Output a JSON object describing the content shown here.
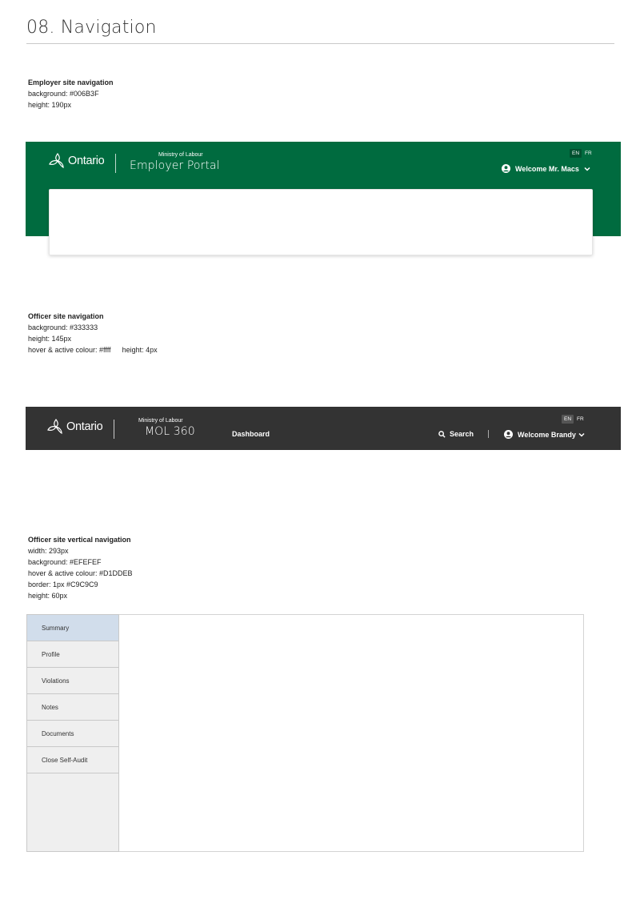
{
  "page": {
    "title": "08. Navigation"
  },
  "employer_spec": {
    "heading": "Employer site navigation",
    "lines": [
      "background: #006B3F",
      "height: 190px"
    ]
  },
  "employer_nav": {
    "logo_text": "Ontario",
    "ministry": "Ministry of Labour",
    "portal": "Employer Portal",
    "lang": [
      "EN",
      "FR"
    ],
    "welcome": "Welcome Mr. Macs",
    "bg_color": "#006B3F"
  },
  "officer_spec": {
    "heading": "Officer site navigation",
    "lines": [
      "background: #333333",
      "height: 145px"
    ],
    "hover": "hover & active colour: #ffff",
    "hover_height": "height:  4px"
  },
  "officer_nav": {
    "logo_text": "Ontario",
    "ministry": "Ministry of Labour",
    "portal": "MOL 360",
    "dashboard": "Dashboard",
    "search": "Search",
    "lang": [
      "EN",
      "FR"
    ],
    "welcome": "Welcome Brandy",
    "bg_color": "#333333"
  },
  "vertical_spec": {
    "heading": "Officer site vertical navigation",
    "lines": [
      "width: 293px",
      "background: #EFEFEF",
      "hover & active colour: #D1DDEB",
      "border: 1px #C9C9C9",
      "height: 60px"
    ]
  },
  "vertical_nav": {
    "items": [
      "Summary",
      "Profile",
      "Violations",
      "Notes",
      "Documents",
      "Close Self-Audit"
    ],
    "active_index": 0
  }
}
